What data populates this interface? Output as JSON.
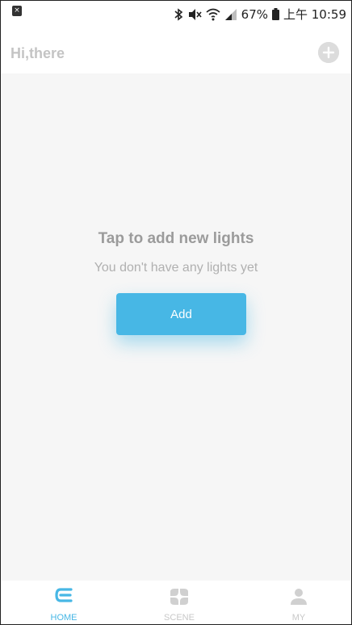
{
  "status_bar": {
    "notification_icon": "close-box-icon",
    "icons": [
      "bluetooth-icon",
      "mute-icon",
      "wifi-icon",
      "signal-icon",
      "battery-icon"
    ],
    "battery": "67%",
    "time": "上午 10:59"
  },
  "header": {
    "greeting": "Hi,there",
    "add_icon": "plus-circle-icon"
  },
  "empty_state": {
    "title": "Tap to add new lights",
    "subtitle": "You don't have any lights yet",
    "add_label": "Add"
  },
  "tabs": [
    {
      "label": "HOME",
      "icon": "home-e-icon",
      "active": true
    },
    {
      "label": "SCENE",
      "icon": "scene-grid-icon",
      "active": false
    },
    {
      "label": "MY",
      "icon": "person-icon",
      "active": false
    }
  ],
  "colors": {
    "accent": "#47b7e5",
    "inactive": "#c8c8c8",
    "background": "#f6f6f6"
  }
}
